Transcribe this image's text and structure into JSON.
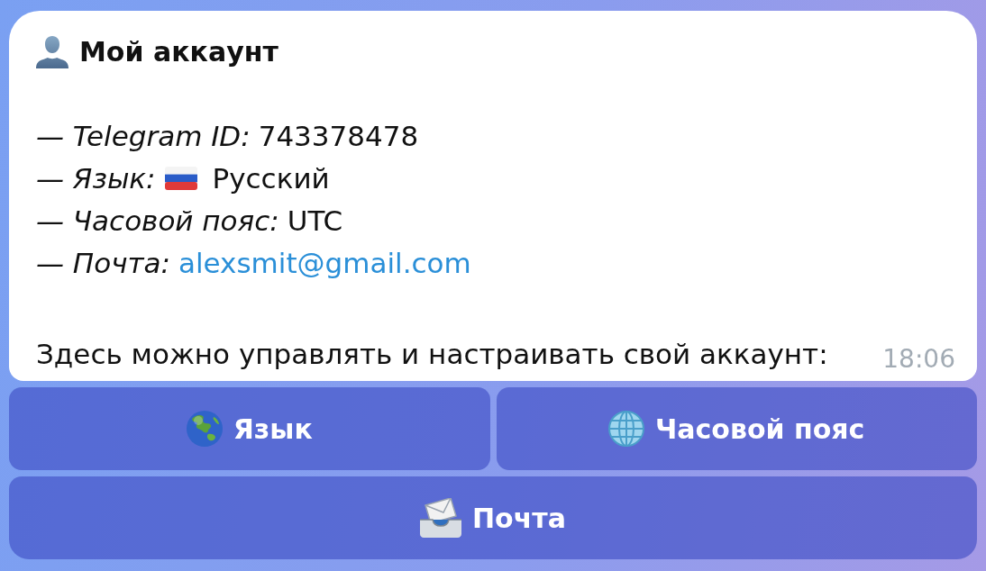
{
  "message": {
    "title": "Мой аккаунт",
    "fields": [
      {
        "kind": "text",
        "label": "— Telegram ID:",
        "value": "743378478"
      },
      {
        "kind": "language",
        "label": "— Язык:",
        "value": "Русский"
      },
      {
        "kind": "text",
        "label": "— Часовой пояс:",
        "value": "UTC"
      },
      {
        "kind": "link",
        "label": "— Почта:",
        "value": "alexsmit@gmail.com"
      }
    ],
    "note": "Здесь можно управлять и настраивать свой аккаунт:",
    "time": "18:06"
  },
  "keyboard": [
    [
      {
        "kind": "language",
        "label": "Язык"
      },
      {
        "kind": "timezone",
        "label": "Часовой пояс"
      }
    ],
    [
      {
        "kind": "email",
        "label": "Почта"
      }
    ]
  ]
}
